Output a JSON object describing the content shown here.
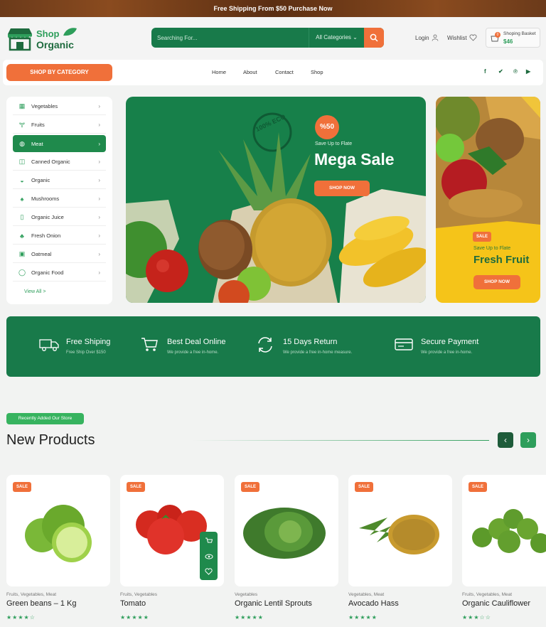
{
  "topbar": {
    "text": "Free Shipping From $50 Purchase Now"
  },
  "logo": {
    "line1": "Shop",
    "line2": "Organic"
  },
  "search": {
    "placeholder": "Searching For...",
    "category": "All Categories"
  },
  "header_links": {
    "login": "Login",
    "wishlist": "Wishlist"
  },
  "basket": {
    "label": "Shoping Basket",
    "amount": "$46",
    "count": "0"
  },
  "nav": {
    "category_button": "SHOP BY CATEGORY",
    "items": [
      "Home",
      "About",
      "Contact",
      "Shop"
    ],
    "social": [
      "facebook-icon",
      "twitter-icon",
      "pinterest-icon",
      "youtube-icon"
    ]
  },
  "sidebar": {
    "items": [
      {
        "label": "Vegetables",
        "icon": "vegetables-icon"
      },
      {
        "label": "Fruits",
        "icon": "fruits-icon"
      },
      {
        "label": "Meat",
        "icon": "meat-icon",
        "active": true
      },
      {
        "label": "Canned Organic",
        "icon": "canned-icon"
      },
      {
        "label": "Organic",
        "icon": "organic-icon"
      },
      {
        "label": "Mushrooms",
        "icon": "mushroom-icon"
      },
      {
        "label": "Organic Juice",
        "icon": "juice-icon"
      },
      {
        "label": "Fresh Onion",
        "icon": "onion-icon"
      },
      {
        "label": "Oatmeal",
        "icon": "oatmeal-icon"
      },
      {
        "label": "Organic Food",
        "icon": "food-icon"
      }
    ],
    "view_all": "View All >"
  },
  "hero": {
    "badge": "%50",
    "eyebrow": "Save Up to Flate",
    "title": "Mega Sale",
    "button": "SHOP NOW",
    "eco": "100% ECO"
  },
  "side_banner": {
    "badge": "SALE",
    "eyebrow": "Save Up to Flate",
    "title": "Fresh Fruit",
    "button": "SHOP NOW"
  },
  "features": [
    {
      "title": "Free Shiping",
      "subtitle": "Free Ship Over $150",
      "icon": "truck-icon"
    },
    {
      "title": "Best Deal Online",
      "subtitle": "We provide a free in-home.",
      "icon": "cart-icon"
    },
    {
      "title": "15 Days Return",
      "subtitle": "We provide a free in-home measure.",
      "icon": "return-icon"
    },
    {
      "title": "Secure Payment",
      "subtitle": "We provide a free in-home.",
      "icon": "card-icon"
    }
  ],
  "new_products": {
    "tag": "Recently Added Our Store",
    "title": "New Products",
    "products": [
      {
        "badge": "SALE",
        "category": "Fruits, Vegetables, Meat",
        "name": "Green beans – 1 Kg",
        "stars": "★★★★☆"
      },
      {
        "badge": "SALE",
        "category": "Fruits, Vegetables",
        "name": "Tomato",
        "stars": "★★★★★"
      },
      {
        "badge": "SALE",
        "category": "Vegetables",
        "name": "Organic Lentil Sprouts",
        "stars": "★★★★★"
      },
      {
        "badge": "SALE",
        "category": "Vegetables, Meat",
        "name": "Avocado Hass",
        "stars": "★★★★★"
      },
      {
        "badge": "SALE",
        "category": "Fruits, Vegetables, Meat",
        "name": "Organic Cauliflower",
        "stars": "★★★☆☆"
      }
    ]
  },
  "colors": {
    "primary": "#187a4a",
    "accent": "#f0703a",
    "banner_yellow": "#f5c419"
  }
}
